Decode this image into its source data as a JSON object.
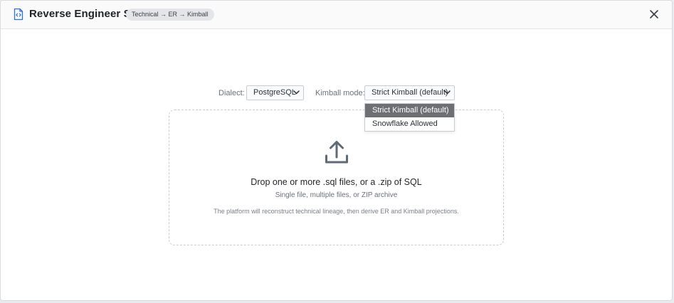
{
  "header": {
    "title": "Reverse Engineer SQL",
    "pill": "Technical → ER → Kimball",
    "icon": "sql-file-icon",
    "close_icon": "close-icon"
  },
  "controls": {
    "dialect_label": "Dialect:",
    "dialect_value": "PostgreSQL",
    "kimball_label": "Kimball mode:",
    "kimball_value": "Strict Kimball (default)",
    "kimball_options": [
      "Strict Kimball (default)",
      "Snowflake Allowed"
    ],
    "kimball_selected_index": 0
  },
  "dropzone": {
    "icon": "upload-icon",
    "title": "Drop one or more .sql files, or a .zip of SQL",
    "subtitle": "Single file, multiple files, or ZIP archive",
    "note": "The platform will reconstruct technical lineage, then derive ER and Kimball projections."
  },
  "colors": {
    "accent": "#2f6fd6",
    "selected_option_bg": "#6d6f72"
  }
}
